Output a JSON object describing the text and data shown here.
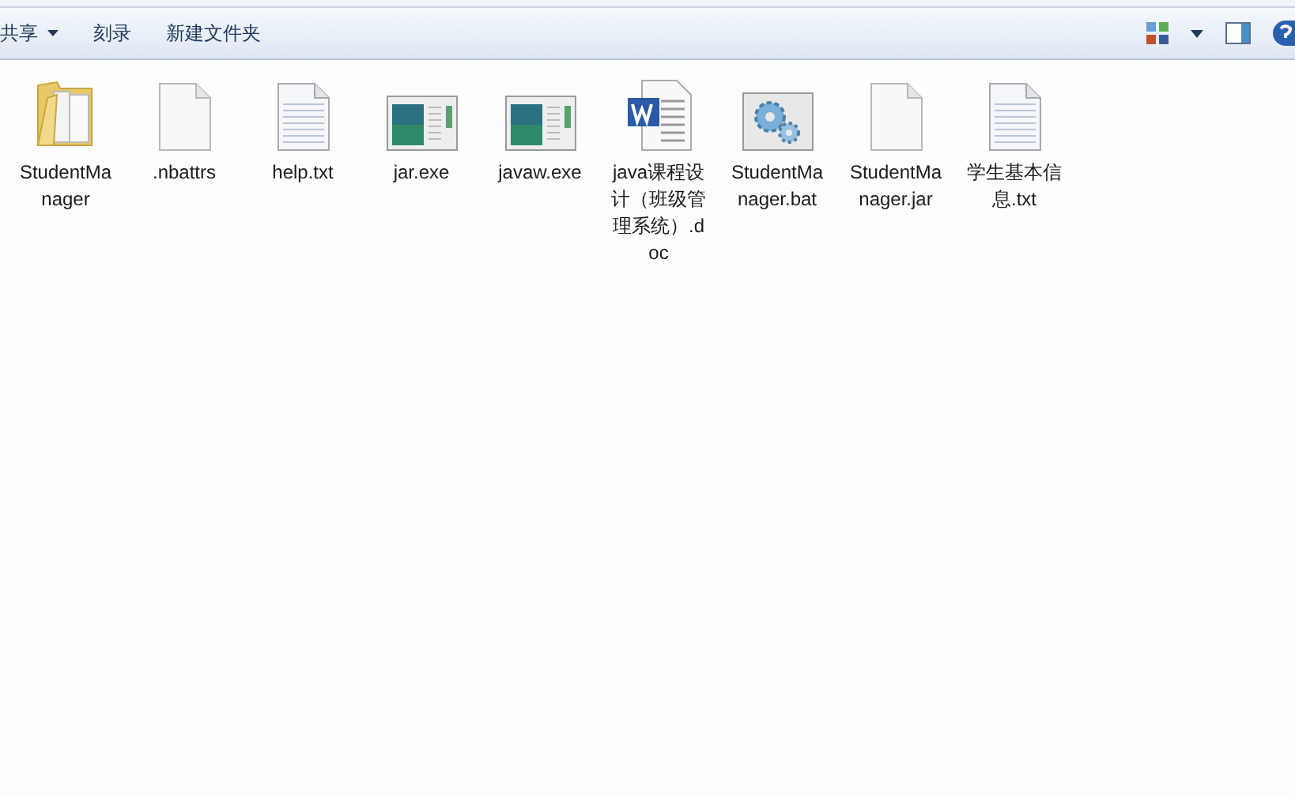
{
  "toolbar": {
    "items": [
      {
        "label": "共享",
        "dropdown": true
      },
      {
        "label": "刻录",
        "dropdown": false
      },
      {
        "label": "新建文件夹",
        "dropdown": false
      }
    ]
  },
  "files": [
    {
      "name": "StudentManager",
      "kind": "folder"
    },
    {
      "name": ".nbattrs",
      "kind": "blank"
    },
    {
      "name": "help.txt",
      "kind": "text"
    },
    {
      "name": "jar.exe",
      "kind": "exe"
    },
    {
      "name": "javaw.exe",
      "kind": "exe"
    },
    {
      "name": "java课程设计（班级管理系统）.doc",
      "kind": "word"
    },
    {
      "name": "StudentManager.bat",
      "kind": "bat"
    },
    {
      "name": "StudentManager.jar",
      "kind": "blank"
    },
    {
      "name": "学生基本信息.txt",
      "kind": "text"
    }
  ]
}
